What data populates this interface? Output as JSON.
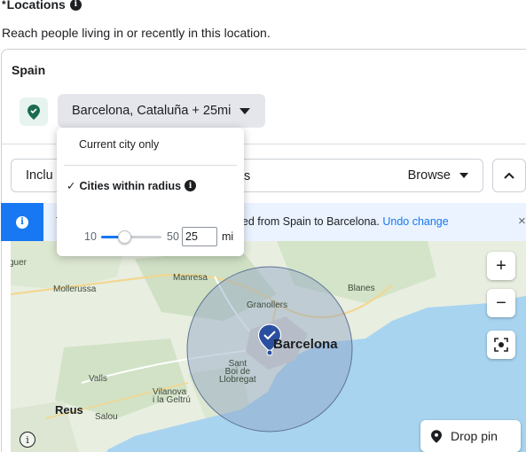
{
  "header": {
    "title_prefix": "*",
    "title": "Locations",
    "subtitle": "Reach people living in or recently in this location."
  },
  "country": "Spain",
  "location_chip": {
    "label": "Barcelona, Cataluña + 25mi"
  },
  "include_bar": {
    "include_label": "Inclu",
    "hidden_tail": "s",
    "browse_label": "Browse"
  },
  "banner": {
    "message_left": "T",
    "message_visible": "nged from Spain to Barcelona.",
    "undo_label": "Undo change",
    "close_label": "×"
  },
  "dropdown": {
    "option_current_city": "Current city only",
    "option_cities_radius": "Cities within radius",
    "checkmark": "✓",
    "slider_min": "10",
    "slider_max": "50",
    "radius_value": "25",
    "unit": "mi",
    "slider_fraction": 0.375
  },
  "map": {
    "labels": {
      "barcelona": "Barcelona",
      "mollerussa": "Mollerussa",
      "manresa": "Manresa",
      "granollers": "Granollers",
      "blanes": "Blanes",
      "sant_boi": "Sant\nBoi de\nLlobregat",
      "vilanova": "Vilanova\ni la Geltrú",
      "valls": "Valls",
      "reus": "Reus",
      "salou": "Salou",
      "aguer": "guer"
    },
    "zoom_in": "+",
    "zoom_out": "−",
    "drop_pin_label": "Drop pin",
    "info": "i"
  },
  "colors": {
    "accent": "#1877f2",
    "pin": "#1a6b4f",
    "map_land": "#e9efe0",
    "map_water": "#a8d4f0",
    "radius_fill": "#8ea1c4"
  }
}
